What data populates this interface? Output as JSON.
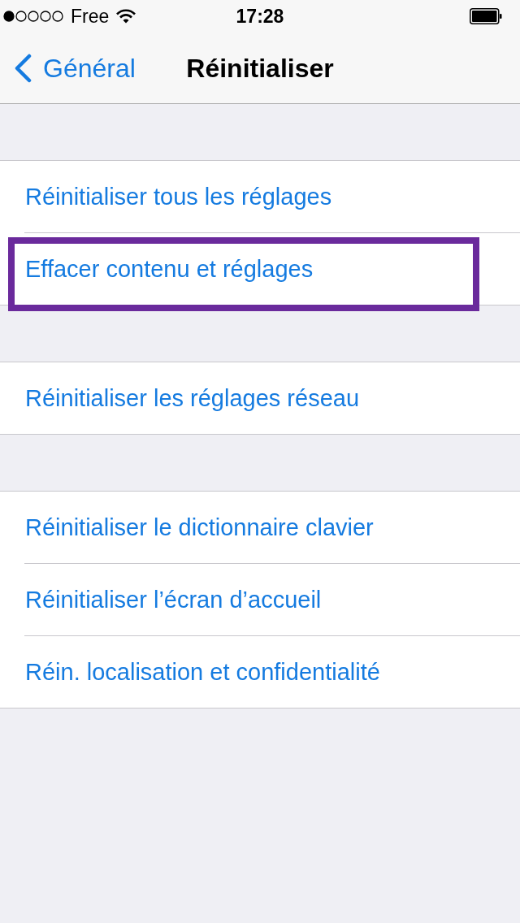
{
  "status_bar": {
    "carrier": "Free",
    "time": "17:28"
  },
  "nav_bar": {
    "back_label": "Général",
    "title": "Réinitialiser"
  },
  "groups": [
    {
      "rows": [
        {
          "label": "Réinitialiser tous les réglages",
          "highlighted": false
        },
        {
          "label": "Effacer contenu et réglages",
          "highlighted": true
        }
      ]
    },
    {
      "rows": [
        {
          "label": "Réinitialiser les réglages réseau",
          "highlighted": false
        }
      ]
    },
    {
      "rows": [
        {
          "label": "Réinitialiser le dictionnaire clavier",
          "highlighted": false
        },
        {
          "label": "Réinitialiser l’écran d’accueil",
          "highlighted": false
        },
        {
          "label": "Réin. localisation et confidentialité",
          "highlighted": false
        }
      ]
    }
  ]
}
